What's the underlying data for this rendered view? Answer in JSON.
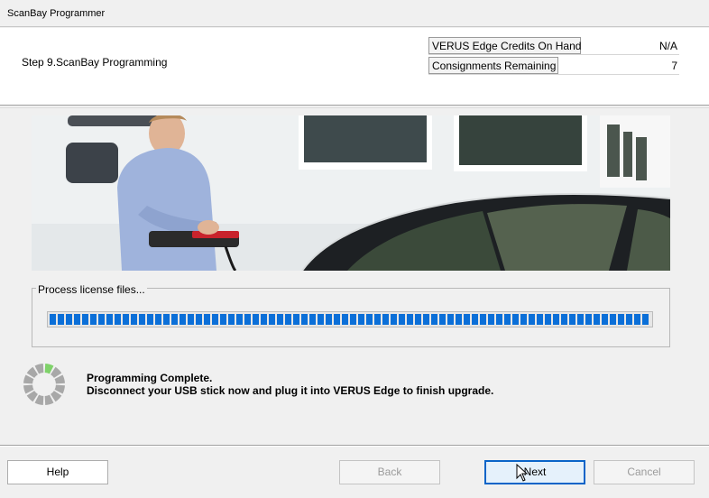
{
  "window": {
    "title": "ScanBay Programmer"
  },
  "header": {
    "step": "Step 9.ScanBay Programming",
    "info": [
      {
        "label": "VERUS Edge Credits On Hand",
        "value": "N/A"
      },
      {
        "label": "Consignments Remaining",
        "value": "7"
      }
    ]
  },
  "progress": {
    "label": "Process license files...",
    "percent": 100,
    "color": "#0b6fd8"
  },
  "status": {
    "line1": "Programming Complete.",
    "line2": "Disconnect your USB stick now and plug it into VERUS Edge to finish upgrade."
  },
  "buttons": {
    "help": "Help",
    "back": "Back",
    "next": "Next",
    "cancel": "Cancel"
  },
  "icons": {
    "spinner": "loading-spinner-icon",
    "cursor": "mouse-pointer-icon"
  }
}
